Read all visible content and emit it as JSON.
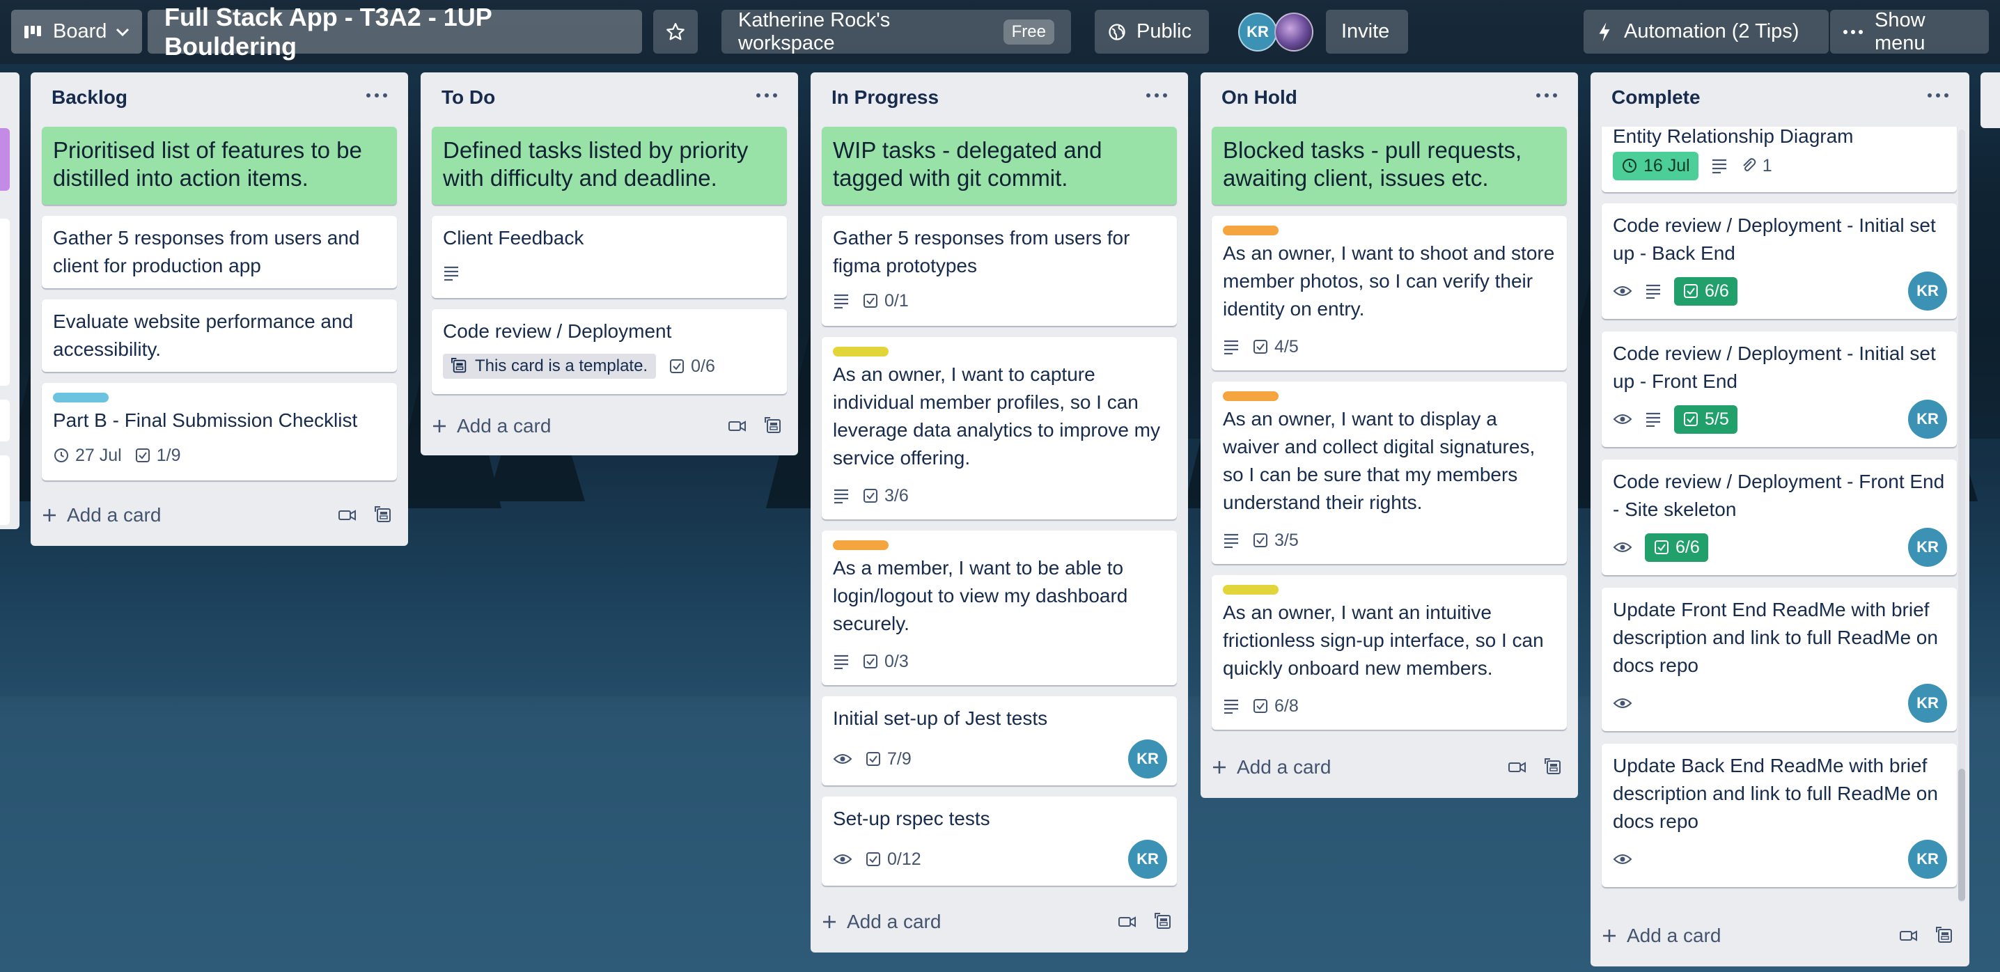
{
  "header": {
    "view_label": "Board",
    "board_title": "Full Stack App - T3A2 - 1UP Bouldering",
    "workspace": "Katherine Rock's workspace",
    "workspace_plan": "Free",
    "visibility": "Public",
    "member_initials": "KR",
    "invite_label": "Invite",
    "automation_label": "Automation (2 Tips)",
    "menu_label": "Show menu"
  },
  "colors": {
    "green_card": "#98e2a8",
    "orange": "#f5a540",
    "yellow": "#e2d53a",
    "cyan": "#6cc3e0",
    "avatar": "#3b92b5"
  },
  "lists": [
    {
      "title": "Backlog",
      "cards": [
        {
          "text": "Prioritised list of features to be distilled into action items."
        },
        {
          "text": "Gather 5 responses from users and client for production app"
        },
        {
          "text": "Evaluate website performance and accessibility."
        },
        {
          "text": "Part B - Final Submission Checklist",
          "date": "27 Jul",
          "checklist": "1/9"
        }
      ],
      "add_label": "Add a card"
    },
    {
      "title": "To Do",
      "cards": [
        {
          "text": "Defined tasks listed by priority with difficulty and deadline."
        },
        {
          "text": "Client Feedback"
        },
        {
          "text": "Code review / Deployment",
          "template": "This card is a template.",
          "checklist": "0/6"
        }
      ],
      "add_label": "Add a card"
    },
    {
      "title": "In Progress",
      "cards": [
        {
          "text": "WIP tasks - delegated and tagged with git commit."
        },
        {
          "text": "Gather 5 responses from users for figma prototypes",
          "checklist": "0/1"
        },
        {
          "text": "As an owner, I want to capture individual member profiles, so I can leverage data analytics to improve my service offering.",
          "checklist": "3/6"
        },
        {
          "text": "As a member, I want to be able to login/logout to view my dashboard securely.",
          "checklist": "0/3"
        },
        {
          "text": "Initial set-up of Jest tests",
          "checklist": "7/9",
          "member": "KR"
        },
        {
          "text": "Set-up rspec tests",
          "checklist": "0/12",
          "member": "KR"
        }
      ],
      "add_label": "Add a card"
    },
    {
      "title": "On Hold",
      "cards": [
        {
          "text": "Blocked tasks - pull requests, awaiting client, issues etc."
        },
        {
          "text": "As an owner, I want to shoot and store member photos, so I can verify their identity on entry.",
          "checklist": "4/5"
        },
        {
          "text": "As an owner, I want to display a waiver and collect digital signatures, so I can be sure that my members understand their rights.",
          "checklist": "3/5"
        },
        {
          "text": "As an owner, I want an intuitive frictionless sign-up interface, so I can quickly onboard new members.",
          "checklist": "6/8"
        }
      ],
      "add_label": "Add a card"
    },
    {
      "title": "Complete",
      "cards": [
        {
          "text": "Entity Relationship Diagram",
          "date": "16 Jul",
          "attachments": "1"
        },
        {
          "text": "Code review / Deployment - Initial set up - Back End",
          "checklist": "6/6",
          "member": "KR"
        },
        {
          "text": "Code review / Deployment - Initial set up - Front End",
          "checklist": "5/5",
          "member": "KR"
        },
        {
          "text": "Code review / Deployment - Front End - Site skeleton",
          "checklist": "6/6",
          "member": "KR"
        },
        {
          "text": "Update Front End ReadMe with brief description and link to full ReadMe on docs repo",
          "member": "KR"
        },
        {
          "text": "Update Back End ReadMe with brief description and link to full ReadMe on docs repo",
          "member": "KR"
        }
      ],
      "add_label": "Add a card"
    }
  ]
}
